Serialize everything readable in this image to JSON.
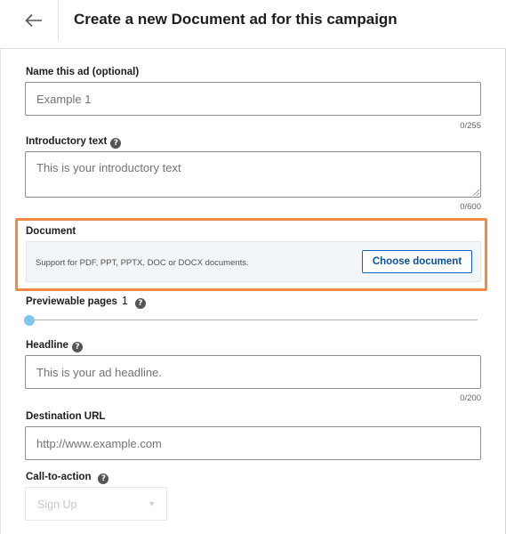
{
  "header": {
    "title": "Create a new Document ad for this campaign"
  },
  "ad_name": {
    "label": "Name this ad (optional)",
    "placeholder": "Example 1",
    "counter": "0/255"
  },
  "intro_text": {
    "label": "Introductory text",
    "placeholder": "This is your introductory text",
    "counter": "0/600"
  },
  "document": {
    "label": "Document",
    "help": "Support for PDF, PPT, PPTX, DOC or DOCX documents.",
    "button_label": "Choose document"
  },
  "previewable_pages": {
    "label": "Previewable pages",
    "value": "1",
    "slider_fraction": 0
  },
  "headline": {
    "label": "Headline",
    "placeholder": "This is your ad headline.",
    "counter": "0/200"
  },
  "destination_url": {
    "label": "Destination URL",
    "placeholder": "http://www.example.com"
  },
  "cta": {
    "label": "Call-to-action",
    "value": "Sign Up"
  },
  "icons": {
    "back": "arrow-left-icon",
    "help": "question-circle-icon",
    "dropdown": "chevron-down-icon"
  },
  "colors": {
    "highlight": "#f08a45",
    "primary": "#0a66c2",
    "slider_thumb": "#7fc7ea"
  }
}
